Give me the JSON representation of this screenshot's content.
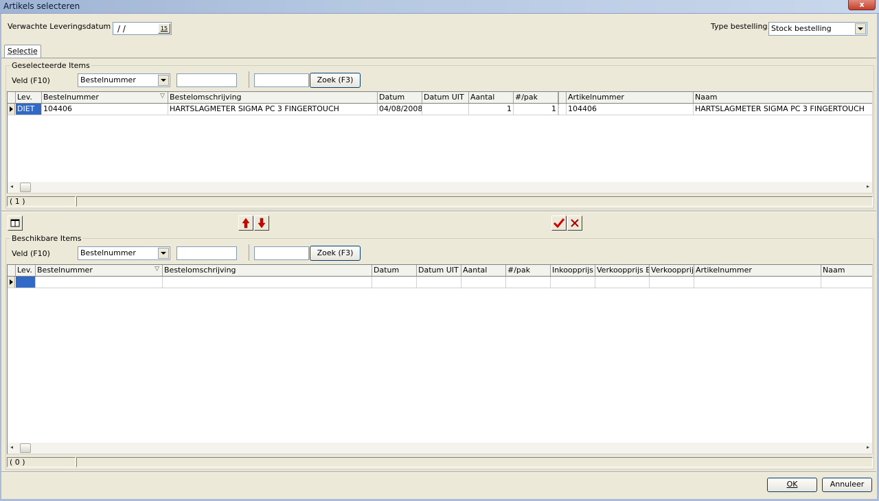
{
  "window": {
    "title": "Artikels selecteren",
    "close_glyph": "x"
  },
  "header": {
    "delivery_label": "Verwachte Leveringsdatum",
    "delivery_value": "/ /",
    "calendar_glyph": "15",
    "order_type_label": "Type bestelling",
    "order_type_value": "Stock bestelling"
  },
  "tabs": [
    {
      "label": "Selectie"
    }
  ],
  "selected": {
    "group_label": "Geselecteerde Items",
    "field_label": "Veld (F10)",
    "field_value": "Bestelnummer",
    "search_button": "Zoek (F3)",
    "columns": [
      "Lev.",
      "Bestelnummer",
      "Bestelomschrijving",
      "Datum",
      "Datum UIT",
      "Aantal",
      "#/pak",
      "Artikelnummer",
      "Naam"
    ],
    "rows": [
      {
        "lev": "DIET",
        "bestelnummer": "104406",
        "omschrijving": "HARTSLAGMETER SIGMA PC 3 FINGERTOUCH",
        "datum": "04/08/2008",
        "datum_uit": "",
        "aantal": "1",
        "pak": "1",
        "artikelnummer": "104406",
        "naam": "HARTSLAGMETER SIGMA PC 3 FINGERTOUCH"
      }
    ],
    "count": "( 1 )"
  },
  "middle": {
    "columns_icon": "columns-icon",
    "up_icon": "arrow-up-icon",
    "down_icon": "arrow-down-icon",
    "check_icon": "checkmark-icon",
    "cross_icon": "cross-icon",
    "colors": {
      "arrow": "#d00000",
      "check": "#d00000",
      "cross": "#a00000"
    }
  },
  "available": {
    "group_label": "Beschikbare Items",
    "field_label": "Veld (F10)",
    "field_value": "Bestelnummer",
    "search_button": "Zoek (F3)",
    "columns": [
      "Lev.",
      "Bestelnummer",
      "Bestelomschrijving",
      "Datum",
      "Datum UIT",
      "Aantal",
      "#/pak",
      "Inkoopprijs",
      "Verkoopprijs Ex",
      "Verkoopprijs",
      "Artikelnummer",
      "Naam"
    ],
    "count": "( 0 )"
  },
  "footer": {
    "ok_label": "OK",
    "cancel_label": "Annuleer"
  }
}
